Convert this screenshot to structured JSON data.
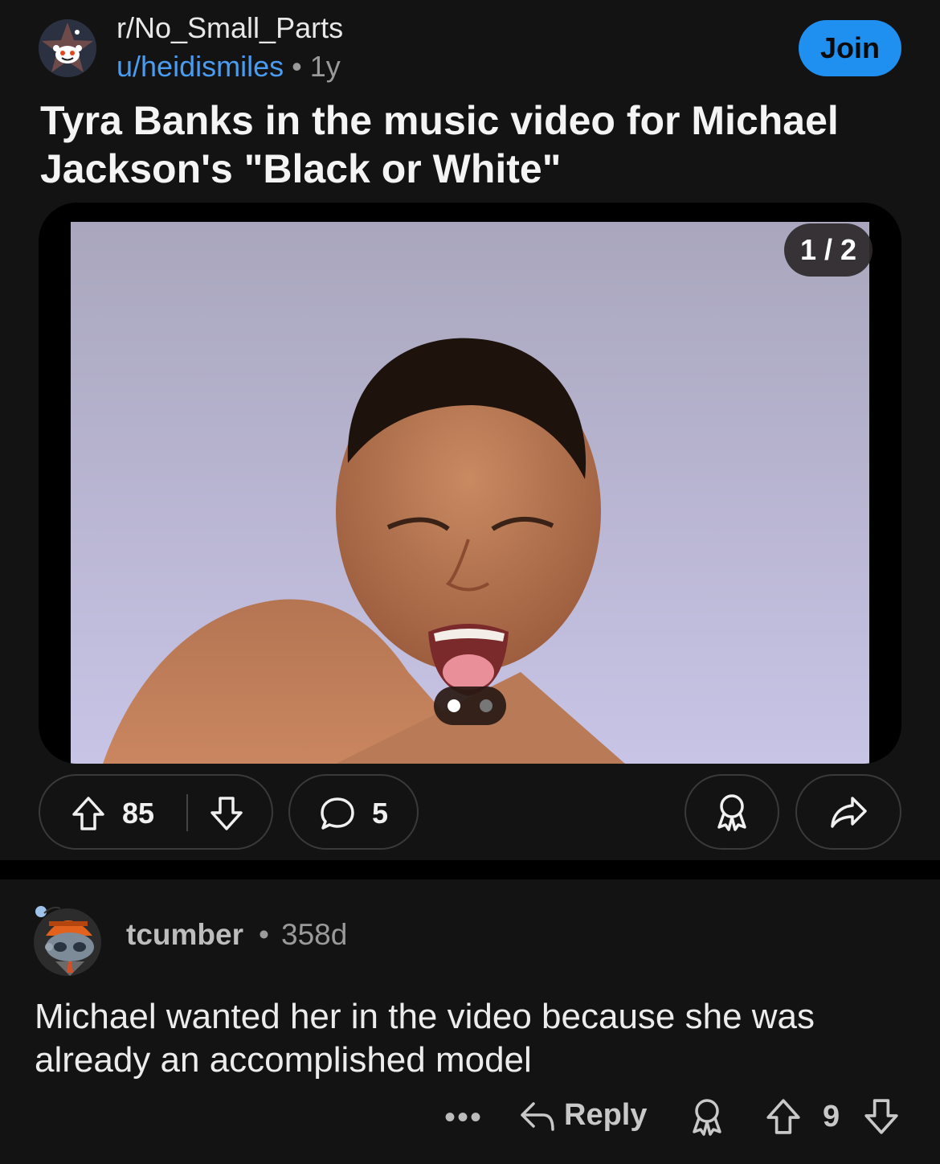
{
  "post": {
    "subreddit": "r/No_Small_Parts",
    "author": "u/heidismiles",
    "separator": "•",
    "age": "1y",
    "join_label": "Join",
    "title": "Tyra Banks in the music video for Michael Jackson's \"Black or White\"",
    "media": {
      "page_indicator": "1 / 2",
      "total_pages": 2,
      "current_page": 1
    },
    "actions": {
      "upvote_count": "85",
      "comment_count": "5",
      "upvote_icon": "arrow-up-icon",
      "downvote_icon": "arrow-down-icon",
      "comment_icon": "speech-bubble-icon",
      "award_icon": "award-ribbon-icon",
      "share_icon": "share-arrow-icon"
    }
  },
  "comment": {
    "username": "tcumber",
    "separator": "•",
    "age": "358d",
    "body": "Michael wanted her in the video because she was already an accomplished model",
    "more_label": "•••",
    "reply_label": "Reply",
    "score": "9"
  },
  "colors": {
    "background": "#131313",
    "accent_blue": "#1f8ff0",
    "link_blue": "#4a9cf0",
    "muted_text": "#9a9a9a"
  }
}
